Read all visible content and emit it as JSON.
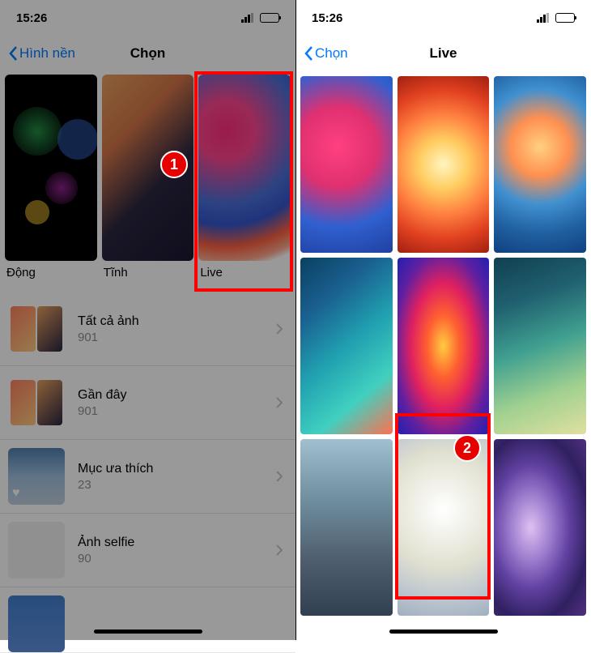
{
  "status": {
    "time": "15:26"
  },
  "left_screen": {
    "back_label": "Hình nền",
    "title": "Chọn",
    "categories": [
      {
        "label": "Động"
      },
      {
        "label": "Tĩnh"
      },
      {
        "label": "Live"
      }
    ],
    "albums": [
      {
        "name": "Tất cả ảnh",
        "count": "901"
      },
      {
        "name": "Gần đây",
        "count": "901"
      },
      {
        "name": "Mục ưa thích",
        "count": "23"
      },
      {
        "name": "Ảnh selfie",
        "count": "90"
      }
    ]
  },
  "right_screen": {
    "back_label": "Chọn",
    "title": "Live"
  },
  "badges": {
    "one": "1",
    "two": "2"
  }
}
